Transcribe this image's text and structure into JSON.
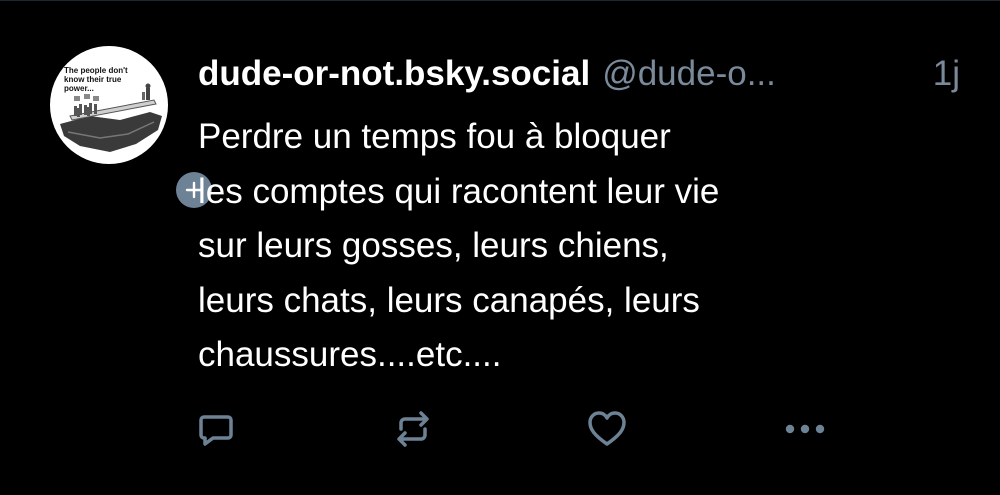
{
  "post": {
    "avatar": {
      "caption": "The people don't know their true power..."
    },
    "author": {
      "display_name": "dude-or-not.bsky.social",
      "handle": "@dude-o...",
      "time": "1j"
    },
    "text": "Perdre un temps fou à bloquer\nles comptes qui racontent leur vie\nsur leurs gosses, leurs chiens,\nleurs chats, leurs canapés, leurs\nchaussures....etc....",
    "actions": [
      "reply-icon",
      "repost-icon",
      "like-icon",
      "more-icon"
    ]
  },
  "colors": {
    "background": "#000000",
    "text": "#ffffff",
    "muted": "#7b8a9a",
    "icon": "#6e8296",
    "badge": "#6e8296"
  }
}
